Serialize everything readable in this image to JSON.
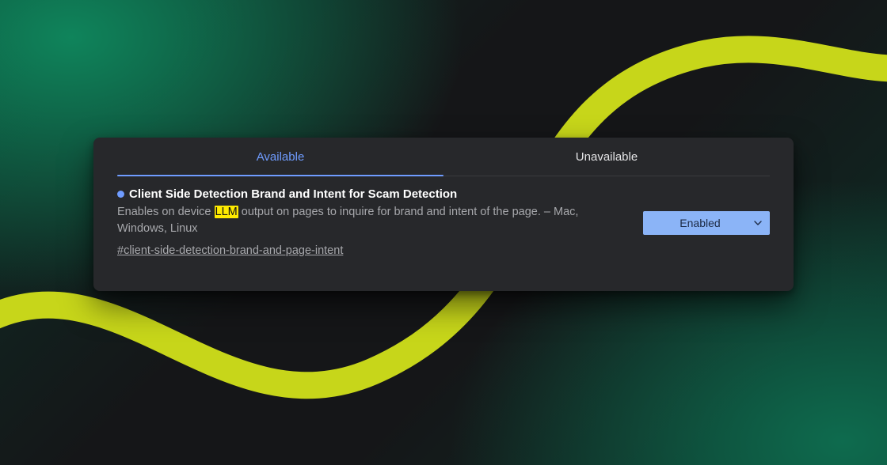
{
  "tabs": {
    "available": "Available",
    "unavailable": "Unavailable",
    "active": "available"
  },
  "flag": {
    "title": "Client Side Detection Brand and Intent for Scam Detection",
    "desc_before": "Enables on device ",
    "desc_highlight": "LLM",
    "desc_after": " output on pages to inquire for brand and intent of the page. – Mac, Windows, Linux",
    "hash": "#client-side-detection-brand-and-page-intent",
    "state_label": "Enabled"
  },
  "colors": {
    "accent": "#6f9cff",
    "select_bg": "#8bb4f7",
    "panel_bg": "#27282b",
    "highlight": "#ffeb00",
    "swoosh": "#c7d61a"
  }
}
